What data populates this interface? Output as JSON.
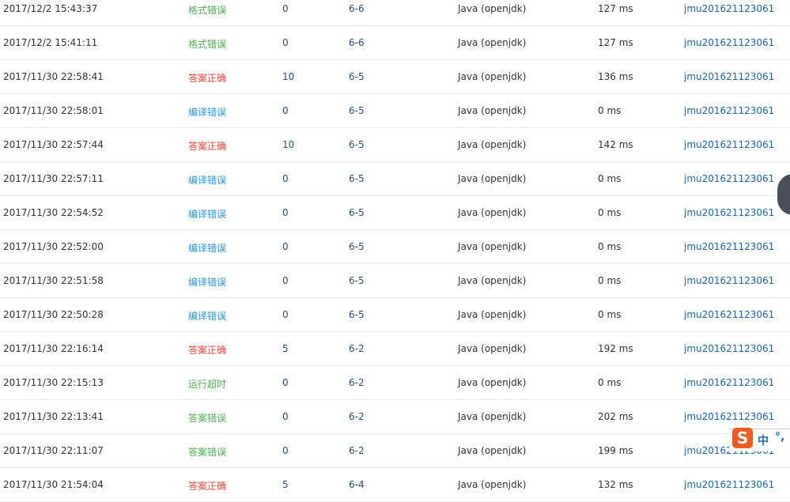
{
  "colors": {
    "格式错误": "#4caf50",
    "答案正确": "#f44336",
    "编译错误": "#2196f3",
    "运行超时": "#4caf50",
    "答案错误": "#4caf50"
  },
  "rows": [
    {
      "time": "2017/12/2 15:43:37",
      "status": "格式错误",
      "score": "0",
      "problem": "6-6",
      "compiler": "Java (openjdk)",
      "runtime": "127 ms",
      "user": "jmu201621123061"
    },
    {
      "time": "2017/12/2 15:41:11",
      "status": "格式错误",
      "score": "0",
      "problem": "6-6",
      "compiler": "Java (openjdk)",
      "runtime": "127 ms",
      "user": "jmu201621123061"
    },
    {
      "time": "2017/11/30 22:58:41",
      "status": "答案正确",
      "score": "10",
      "problem": "6-5",
      "compiler": "Java (openjdk)",
      "runtime": "136 ms",
      "user": "jmu201621123061"
    },
    {
      "time": "2017/11/30 22:58:01",
      "status": "编译错误",
      "score": "0",
      "problem": "6-5",
      "compiler": "Java (openjdk)",
      "runtime": "0 ms",
      "user": "jmu201621123061"
    },
    {
      "time": "2017/11/30 22:57:44",
      "status": "答案正确",
      "score": "10",
      "problem": "6-5",
      "compiler": "Java (openjdk)",
      "runtime": "142 ms",
      "user": "jmu201621123061"
    },
    {
      "time": "2017/11/30 22:57:11",
      "status": "编译错误",
      "score": "0",
      "problem": "6-5",
      "compiler": "Java (openjdk)",
      "runtime": "0 ms",
      "user": "jmu201621123061"
    },
    {
      "time": "2017/11/30 22:54:52",
      "status": "编译错误",
      "score": "0",
      "problem": "6-5",
      "compiler": "Java (openjdk)",
      "runtime": "0 ms",
      "user": "jmu201621123061"
    },
    {
      "time": "2017/11/30 22:52:00",
      "status": "编译错误",
      "score": "0",
      "problem": "6-5",
      "compiler": "Java (openjdk)",
      "runtime": "0 ms",
      "user": "jmu201621123061"
    },
    {
      "time": "2017/11/30 22:51:58",
      "status": "编译错误",
      "score": "0",
      "problem": "6-5",
      "compiler": "Java (openjdk)",
      "runtime": "0 ms",
      "user": "jmu201621123061"
    },
    {
      "time": "2017/11/30 22:50:28",
      "status": "编译错误",
      "score": "0",
      "problem": "6-5",
      "compiler": "Java (openjdk)",
      "runtime": "0 ms",
      "user": "jmu201621123061"
    },
    {
      "time": "2017/11/30 22:16:14",
      "status": "答案正确",
      "score": "5",
      "problem": "6-2",
      "compiler": "Java (openjdk)",
      "runtime": "192 ms",
      "user": "jmu201621123061"
    },
    {
      "time": "2017/11/30 22:15:13",
      "status": "运行超时",
      "score": "0",
      "problem": "6-2",
      "compiler": "Java (openjdk)",
      "runtime": "0 ms",
      "user": "jmu201621123061"
    },
    {
      "time": "2017/11/30 22:13:41",
      "status": "答案错误",
      "score": "0",
      "problem": "6-2",
      "compiler": "Java (openjdk)",
      "runtime": "202 ms",
      "user": "jmu201621123061"
    },
    {
      "time": "2017/11/30 22:11:07",
      "status": "答案错误",
      "score": "0",
      "problem": "6-2",
      "compiler": "Java (openjdk)",
      "runtime": "199 ms",
      "user": "jmu201621123061"
    },
    {
      "time": "2017/11/30 21:54:04",
      "status": "答案正确",
      "score": "5",
      "problem": "6-4",
      "compiler": "Java (openjdk)",
      "runtime": "132 ms",
      "user": "jmu201621123061"
    }
  ],
  "ime": {
    "logo": "S",
    "mode": "中",
    "punct": "°,"
  }
}
